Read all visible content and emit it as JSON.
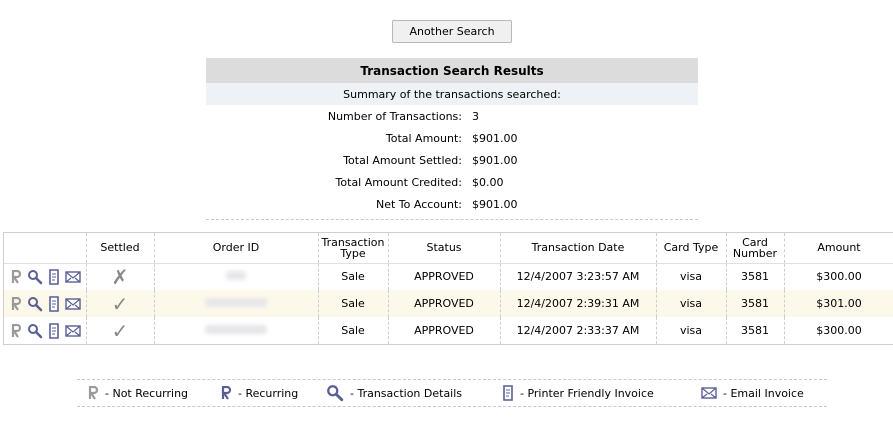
{
  "search_button": {
    "label": "Another Search"
  },
  "summary": {
    "title": "Transaction Search Results",
    "subtitle": "Summary of the transactions searched:",
    "rows": [
      {
        "label": "Number of Transactions:",
        "value": "3"
      },
      {
        "label": "Total Amount:",
        "value": "$901.00"
      },
      {
        "label": "Total Amount Settled:",
        "value": "$901.00"
      },
      {
        "label": "Total Amount Credited:",
        "value": "$0.00"
      },
      {
        "label": "Net To Account:",
        "value": "$901.00"
      }
    ]
  },
  "table": {
    "headers": {
      "settled": "Settled",
      "order_id": "Order ID",
      "transaction_type_1": "Transaction",
      "transaction_type_2": "Type",
      "status": "Status",
      "transaction_date": "Transaction Date",
      "card_type": "Card Type",
      "card_number_1": "Card",
      "card_number_2": "Number",
      "amount": "Amount"
    },
    "rows": [
      {
        "settled": "✗",
        "type": "Sale",
        "status": "APPROVED",
        "date": "12/4/2007 3:23:57 AM",
        "card_type": "visa",
        "card_number": "3581",
        "amount": "$300.00"
      },
      {
        "settled": "✓",
        "type": "Sale",
        "status": "APPROVED",
        "date": "12/4/2007 2:39:31 AM",
        "card_type": "visa",
        "card_number": "3581",
        "amount": "$301.00"
      },
      {
        "settled": "✓",
        "type": "Sale",
        "status": "APPROVED",
        "date": "12/4/2007 2:33:37 AM",
        "card_type": "visa",
        "card_number": "3581",
        "amount": "$300.00"
      }
    ]
  },
  "legend": {
    "not_recurring": "- Not Recurring",
    "recurring": "- Recurring",
    "transaction_details": "- Transaction Details",
    "printer_invoice": "- Printer Friendly Invoice",
    "email_invoice": "- Email Invoice"
  },
  "colors": {
    "accent": "#5a5f95",
    "header_bg": "#dcdcdc",
    "subheader_bg": "#eef1f6",
    "alt_row": "#fdf9ea"
  },
  "icons": [
    "recurring-r-icon",
    "magnifier-icon",
    "invoice-icon",
    "email-envelope-icon"
  ]
}
